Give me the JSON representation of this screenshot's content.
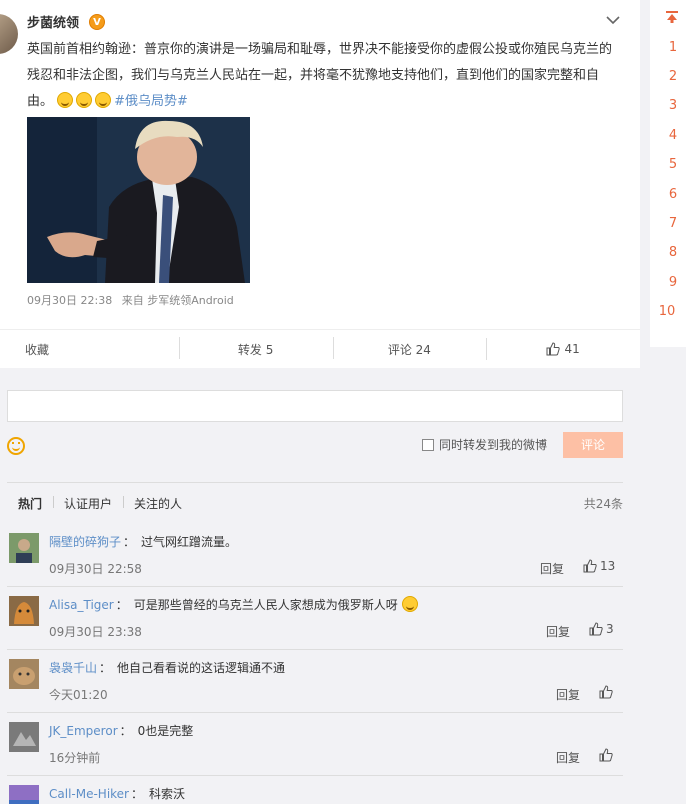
{
  "post": {
    "author": "步菌统领",
    "verified_badge": "V",
    "text": "英国前首相约翰逊：普京你的演讲是一场骗局和耻辱，世界决不能接受你的虚假公投或你殖民乌克兰的残忍和非法企图，我们与乌克兰人民站在一起，并将毫不犹豫地支持他们，直到他们的国家完整和自由。",
    "hashtag": "#俄乌局势#",
    "date": "09月30日 22:38",
    "source": "来自 步军统领Android"
  },
  "actions": {
    "favorite": "收藏",
    "repost": "转发 5",
    "comment": "评论 24",
    "like_count": "41"
  },
  "composer": {
    "placeholder": "",
    "repost_option": "同时转发到我的微博",
    "submit": "评论"
  },
  "filters": {
    "hot": "热门",
    "verified": "认证用户",
    "following": "关注的人",
    "total": "共24条"
  },
  "comments": [
    {
      "user": "隔壁的碎狗子",
      "text": "过气网红蹭流量。",
      "time": "09月30日 22:58",
      "reply": "回复",
      "likes": "13"
    },
    {
      "user": "Alisa_Tiger",
      "text": "可是那些曾经的乌克兰人民人家想成为俄罗斯人呀",
      "time": "09月30日 23:38",
      "reply": "回复",
      "likes": "3"
    },
    {
      "user": "袅袅千山",
      "text": "他自己看看说的这话逻辑通不通",
      "time": "今天01:20",
      "reply": "回复",
      "likes": ""
    },
    {
      "user": "JK_Emperor",
      "text": "0也是完整",
      "time": "16分钟前",
      "reply": "回复",
      "likes": ""
    },
    {
      "user": "Call-Me-Hiker",
      "text": "科索沃",
      "time": "",
      "reply": "",
      "likes": ""
    }
  ],
  "pager": [
    "1",
    "2",
    "3",
    "4",
    "5",
    "6",
    "7",
    "8",
    "9",
    "10"
  ],
  "colors": {
    "accent": "#e8663d",
    "link": "#5d8ec7",
    "submit_disabled": "#fdc0a5"
  }
}
